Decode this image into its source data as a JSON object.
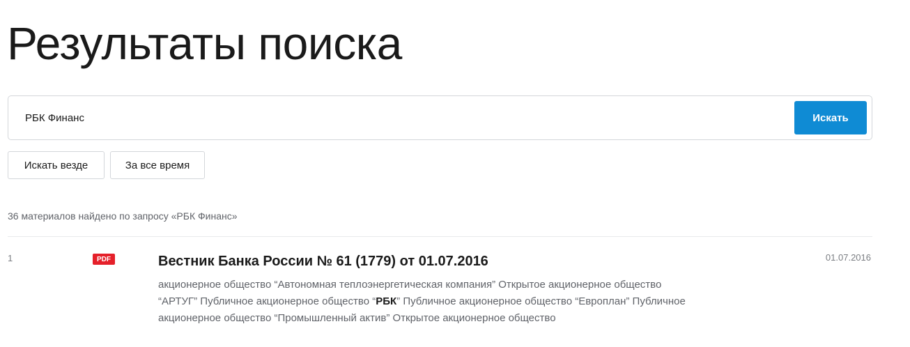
{
  "header": {
    "title": "Результаты поиска"
  },
  "search": {
    "value": "РБК Финанс",
    "button_label": "Искать"
  },
  "filters": {
    "scope_label": "Искать везде",
    "time_label": "За все время"
  },
  "results_summary": "36 материалов найдено по запросу «РБК Финанс»",
  "results": [
    {
      "index": "1",
      "badge": "PDF",
      "title": "Вестник Банка России № 61 (1779) от 01.07.2016",
      "date": "01.07.2016",
      "snippet_before": "акционерное общество “Автономная теплоэнергетическая компания” Открытое акционерное общество “АРТУГ” Публичное акционерное общество “",
      "snippet_highlight": "РБК",
      "snippet_after": "” Публичное акционерное общество “Европлан” Публичное акционерное общество “Промышленный актив” Открытое акционерное общество"
    }
  ],
  "colors": {
    "accent": "#0f8bd4",
    "pdf_badge": "#e5202a",
    "muted_text": "#5f6268"
  },
  "icons": {
    "pdf_badge": "pdf-icon"
  }
}
